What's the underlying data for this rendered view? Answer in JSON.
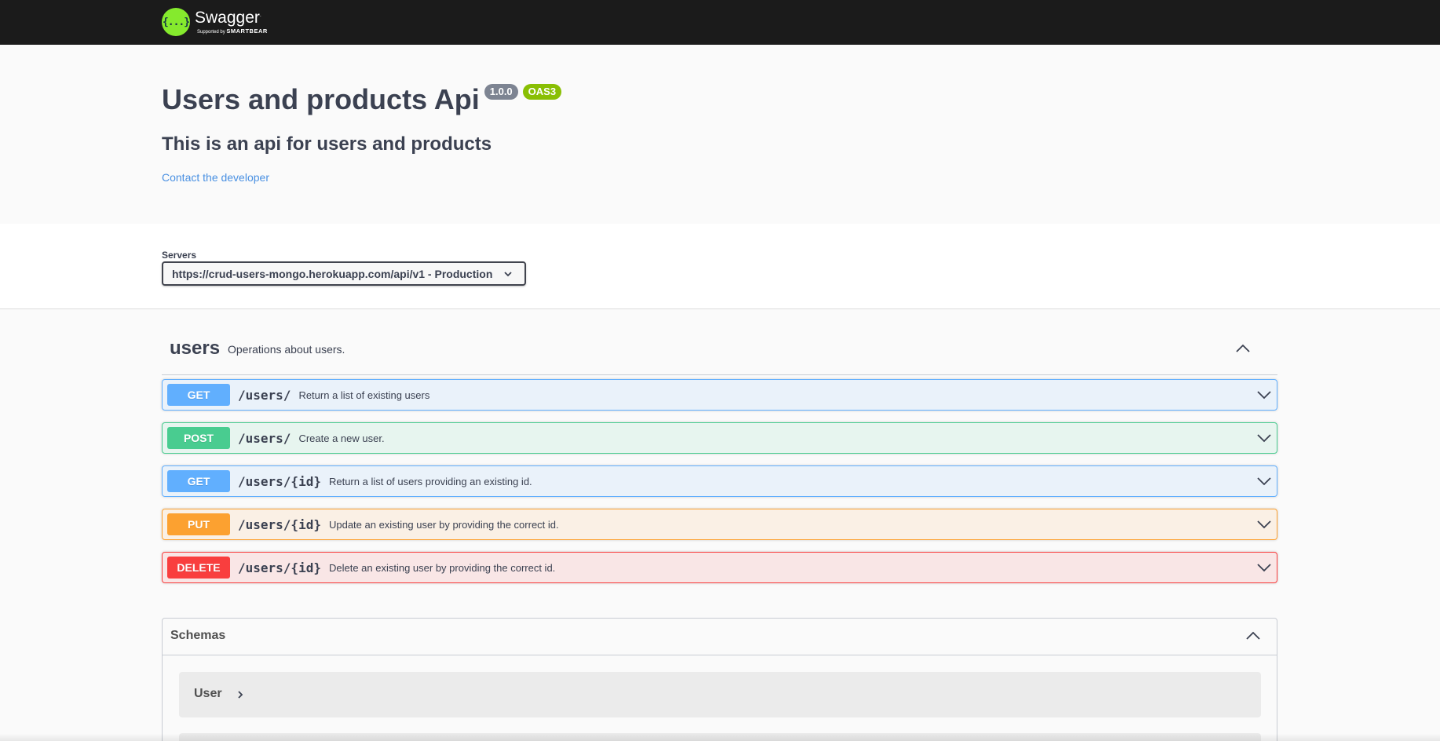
{
  "topbar": {
    "logo_mark": "{...}",
    "brand": "Swagger",
    "brand_tm": ".",
    "supported_by": "Supported by",
    "smartbear": "SMARTBEAR",
    "bg_color": "#1b1b1b",
    "logo_color": "#85ea2d"
  },
  "info": {
    "title": "Users and products Api",
    "version": "1.0.0",
    "oas": "OAS3",
    "description": "This is an api for users and products",
    "contact_link": "Contact the developer"
  },
  "servers": {
    "label": "Servers",
    "selected": "https://crud-users-mongo.herokuapp.com/api/v1 - Production"
  },
  "tag": {
    "name": "users",
    "description": "Operations about users.",
    "expanded": true
  },
  "operations": [
    {
      "method": "GET",
      "path": "/users/",
      "summary": "Return a list of existing users",
      "color": "#61affe"
    },
    {
      "method": "POST",
      "path": "/users/",
      "summary": "Create a new user.",
      "color": "#49cc90"
    },
    {
      "method": "GET",
      "path": "/users/{id}",
      "summary": "Return a list of users providing an existing id.",
      "color": "#61affe"
    },
    {
      "method": "PUT",
      "path": "/users/{id}",
      "summary": "Update an existing user by providing the correct id.",
      "color": "#fca130"
    },
    {
      "method": "DELETE",
      "path": "/users/{id}",
      "summary": "Delete an existing user by providing the correct id.",
      "color": "#f93e3e"
    }
  ],
  "schemas": {
    "title": "Schemas",
    "expanded": true,
    "models": [
      {
        "name": "User"
      }
    ]
  }
}
